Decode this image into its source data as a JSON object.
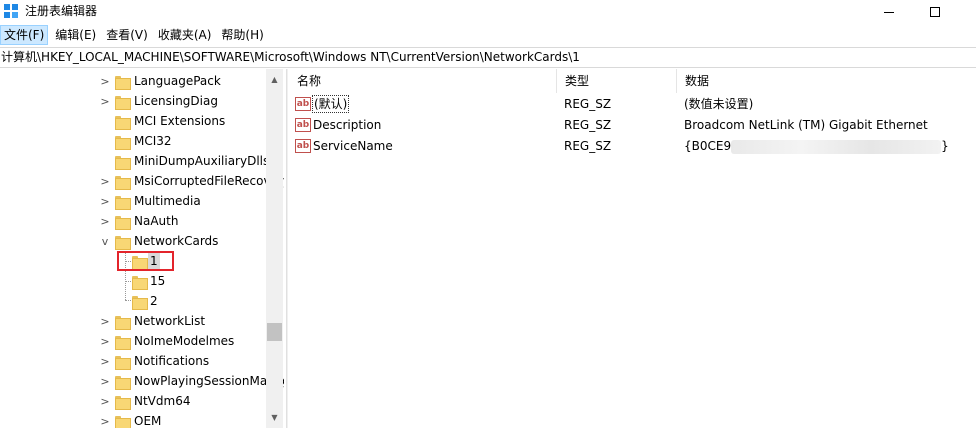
{
  "window": {
    "title": "注册表编辑器"
  },
  "menu": [
    {
      "label": "文件(F)",
      "active": true
    },
    {
      "label": "编辑(E)"
    },
    {
      "label": "查看(V)"
    },
    {
      "label": "收藏夹(A)"
    },
    {
      "label": "帮助(H)"
    }
  ],
  "address": "计算机\\HKEY_LOCAL_MACHINE\\SOFTWARE\\Microsoft\\Windows NT\\CurrentVersion\\NetworkCards\\1",
  "tree": {
    "items": [
      {
        "label": "LanguagePack",
        "toggle": ">"
      },
      {
        "label": "LicensingDiag",
        "toggle": ">"
      },
      {
        "label": "MCI Extensions",
        "toggle": ""
      },
      {
        "label": "MCI32",
        "toggle": ""
      },
      {
        "label": "MiniDumpAuxiliaryDlls",
        "toggle": ""
      },
      {
        "label": "MsiCorruptedFileRecovery",
        "toggle": ">"
      },
      {
        "label": "Multimedia",
        "toggle": ">"
      },
      {
        "label": "NaAuth",
        "toggle": ">"
      },
      {
        "label": "NetworkCards",
        "toggle": "v"
      },
      {
        "label": "1",
        "toggle": ""
      },
      {
        "label": "15",
        "toggle": ""
      },
      {
        "label": "2",
        "toggle": ""
      },
      {
        "label": "NetworkList",
        "toggle": ">"
      },
      {
        "label": "NoImeModelmes",
        "toggle": ">"
      },
      {
        "label": "Notifications",
        "toggle": ">"
      },
      {
        "label": "NowPlayingSessionManager",
        "toggle": ">"
      },
      {
        "label": "NtVdm64",
        "toggle": ">"
      },
      {
        "label": "OEM",
        "toggle": ">"
      }
    ]
  },
  "list": {
    "columns": {
      "name": "名称",
      "type": "类型",
      "data": "数据"
    },
    "rows": [
      {
        "name": "(默认)",
        "type": "REG_SZ",
        "data": "(数值未设置)"
      },
      {
        "name": "Description",
        "type": "REG_SZ",
        "data": "Broadcom NetLink (TM) Gigabit Ethernet"
      },
      {
        "name": "ServiceName",
        "type": "REG_SZ",
        "data_prefix": "{B0CE9",
        "data_suffix": "}"
      }
    ]
  },
  "colors": {
    "selection_box": "#e3242b",
    "menu_active": "#cce8ff"
  }
}
